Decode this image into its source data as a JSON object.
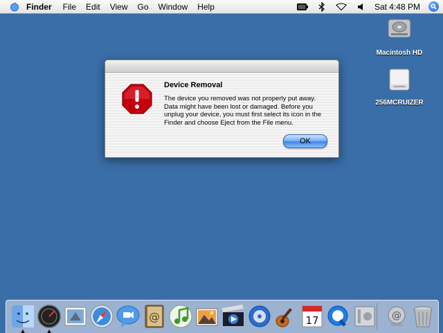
{
  "menubar": {
    "apple_icon": "apple-icon",
    "app_name": "Finder",
    "items": [
      {
        "label": "File"
      },
      {
        "label": "Edit"
      },
      {
        "label": "View"
      },
      {
        "label": "Go"
      },
      {
        "label": "Window"
      },
      {
        "label": "Help"
      }
    ],
    "status_icons": [
      "battery-icon",
      "bluetooth-icon",
      "wifi-icon",
      "volume-icon"
    ],
    "clock": "Sat 4:48 PM",
    "spotlight_icon": "spotlight-icon"
  },
  "desktop": {
    "background_color": "#3a6ea8",
    "icons": [
      {
        "label": "Macintosh HD",
        "icon": "hard-drive-icon"
      },
      {
        "label": "256MCRUIZER",
        "icon": "removable-drive-icon"
      }
    ]
  },
  "dialog": {
    "title": "Device Removal",
    "message": "The device you removed was not properly put away. Data might have been lost or damaged. Before you unplug your device, you must first select its icon in the Finder and choose Eject from the File menu.",
    "ok_label": "OK",
    "icon": "stop-icon",
    "accent_color": "#d0021b"
  },
  "dock": {
    "apps": [
      {
        "name": "finder-icon",
        "running": true
      },
      {
        "name": "dashboard-icon",
        "running": true
      },
      {
        "name": "mail-icon",
        "running": false
      },
      {
        "name": "safari-icon",
        "running": false
      },
      {
        "name": "ichat-icon",
        "running": false
      },
      {
        "name": "address-book-icon",
        "running": false
      },
      {
        "name": "itunes-icon",
        "running": false
      },
      {
        "name": "iphoto-icon",
        "running": false
      },
      {
        "name": "imovie-icon",
        "running": false
      },
      {
        "name": "idvd-icon",
        "running": false
      },
      {
        "name": "garageband-icon",
        "running": false
      },
      {
        "name": "ical-icon",
        "running": false
      },
      {
        "name": "quicktime-icon",
        "running": false
      },
      {
        "name": "system-preferences-icon",
        "running": false
      }
    ],
    "ical_date": "17",
    "trailing": [
      {
        "name": "mail-drop-icon"
      },
      {
        "name": "trash-icon"
      }
    ]
  }
}
